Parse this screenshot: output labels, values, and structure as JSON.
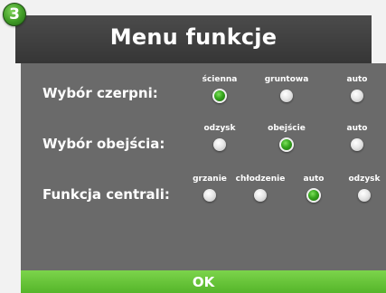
{
  "step_number": "3",
  "title": "Menu funkcje",
  "rows": [
    {
      "label": "Wybór czerpni:",
      "options": [
        {
          "label": "ścienna",
          "selected": true
        },
        {
          "label": "gruntowa",
          "selected": false
        },
        {
          "label": "auto",
          "selected": false
        }
      ]
    },
    {
      "label": "Wybór obejścia:",
      "options": [
        {
          "label": "odzysk",
          "selected": false
        },
        {
          "label": "obejście",
          "selected": true
        },
        {
          "label": "auto",
          "selected": false
        }
      ]
    },
    {
      "label": "Funkcja centrali:",
      "options": [
        {
          "label": "grzanie",
          "selected": false
        },
        {
          "label": "chłodzenie",
          "selected": false
        },
        {
          "label": "auto",
          "selected": true
        },
        {
          "label": "odzysk",
          "selected": false
        }
      ]
    }
  ],
  "ok_label": "OK",
  "colors": {
    "accent_green": "#55b52a",
    "panel": "#6a6a6a",
    "header": "#3d3d3d"
  }
}
